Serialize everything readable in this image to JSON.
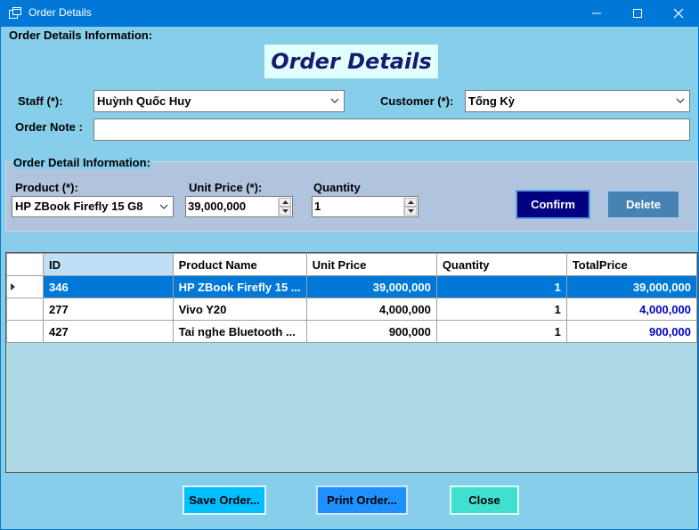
{
  "window": {
    "title": "Order Details",
    "controls": [
      "minimize-icon",
      "maximize-icon",
      "close-icon"
    ]
  },
  "order_info": {
    "group_label": "Order Details Information:",
    "header": "Order Details",
    "staff_label": "Staff (*):",
    "staff_value": "Huỳnh Quốc Huy",
    "customer_label": "Customer (*):",
    "customer_value": "Tống Kỳ",
    "note_label": "Order Note :",
    "note_value": ""
  },
  "detail_info": {
    "group_label": "Order Detail Information:",
    "product_label": "Product (*):",
    "product_value": "HP ZBook Firefly 15 G8",
    "unit_price_label": "Unit Price (*):",
    "unit_price_value": "39,000,000",
    "quantity_label": "Quantity",
    "quantity_value": "1",
    "confirm_label": "Confirm",
    "delete_label": "Delete"
  },
  "grid": {
    "columns": [
      "ID",
      "Product Name",
      "Unit Price",
      "Quantity",
      "TotalPrice"
    ],
    "rows": [
      {
        "id": "346",
        "product": "HP ZBook Firefly 15 ...",
        "unit_price": "39,000,000",
        "quantity": "1",
        "total": "39,000,000"
      },
      {
        "id": "277",
        "product": "Vivo Y20",
        "unit_price": "4,000,000",
        "quantity": "1",
        "total": "4,000,000"
      },
      {
        "id": "427",
        "product": "Tai nghe Bluetooth ...",
        "unit_price": "900,000",
        "quantity": "1",
        "total": "900,000"
      }
    ],
    "selected_row": 0
  },
  "footer": {
    "save_label": "Save Order...",
    "print_label": "Print Order...",
    "close_label": "Close"
  },
  "colors": {
    "title_bar": "#0078d7",
    "form_background": "#87ceeb",
    "header_text": "#191970",
    "confirm_button": "#000080",
    "delete_button": "#4682b4",
    "save_button": "#00bfff",
    "print_button": "#1e90ff",
    "close_button": "#40e0d0",
    "selected_row": "#0078d7",
    "total_text": "#0000cd"
  }
}
